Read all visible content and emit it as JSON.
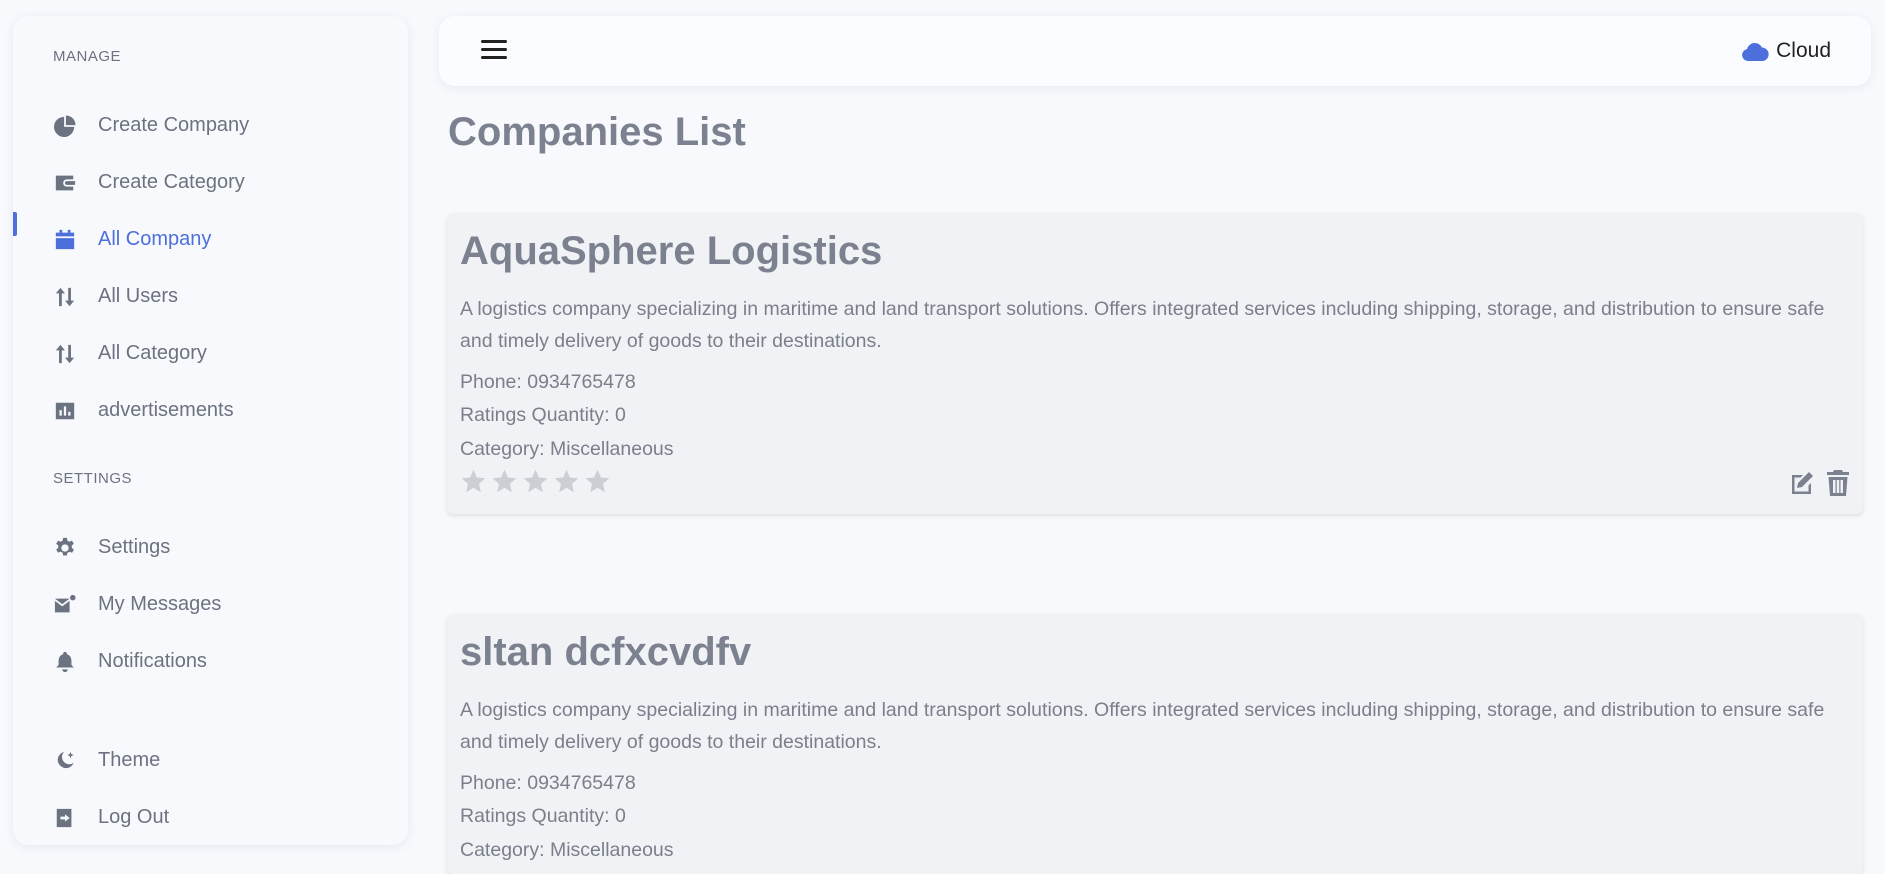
{
  "sidebar": {
    "manage_label": "MANAGE",
    "settings_label": "SETTINGS",
    "manage_items": [
      {
        "label": "Create Company",
        "icon": "pie-chart-icon"
      },
      {
        "label": "Create Category",
        "icon": "wallet-icon"
      },
      {
        "label": "All Company",
        "icon": "calendar-icon",
        "active": true
      },
      {
        "label": "All Users",
        "icon": "sort-arrows-icon"
      },
      {
        "label": "All Category",
        "icon": "sort-arrows-icon"
      },
      {
        "label": "advertisements",
        "icon": "bar-chart-icon"
      }
    ],
    "settings_items": [
      {
        "label": "Settings",
        "icon": "gear-icon"
      },
      {
        "label": "My Messages",
        "icon": "mail-icon"
      },
      {
        "label": "Notifications",
        "icon": "bell-icon"
      }
    ],
    "bottom_items": [
      {
        "label": "Theme",
        "icon": "moon-icon"
      },
      {
        "label": "Log Out",
        "icon": "logout-icon"
      }
    ]
  },
  "topbar": {
    "menu_icon": "hamburger-icon",
    "cloud_label": "Cloud",
    "cloud_icon": "cloud-icon"
  },
  "page": {
    "title": "Companies List"
  },
  "companies": [
    {
      "name": "AquaSphere Logistics",
      "description": "A logistics company specializing in maritime and land transport solutions. Offers integrated services including shipping, storage, and distribution to ensure safe and timely delivery of goods to their destinations.",
      "phone": "Phone: 0934765478",
      "ratings": "Ratings Quantity: 0",
      "category": "Category: Miscellaneous",
      "stars_filled": 0,
      "stars_total": 5
    },
    {
      "name": "sltan dcfxcvdfv",
      "description": "A logistics company specializing in maritime and land transport solutions. Offers integrated services including shipping, storage, and distribution to ensure safe and timely delivery of goods to their destinations.",
      "phone": "Phone: 0934765478",
      "ratings": "Ratings Quantity: 0",
      "category": "Category: Miscellaneous"
    }
  ],
  "colors": {
    "accent": "#4c6fdb",
    "text_muted": "#6b7280",
    "card_bg": "#f1f2f5",
    "star_empty": "#cdced3"
  }
}
